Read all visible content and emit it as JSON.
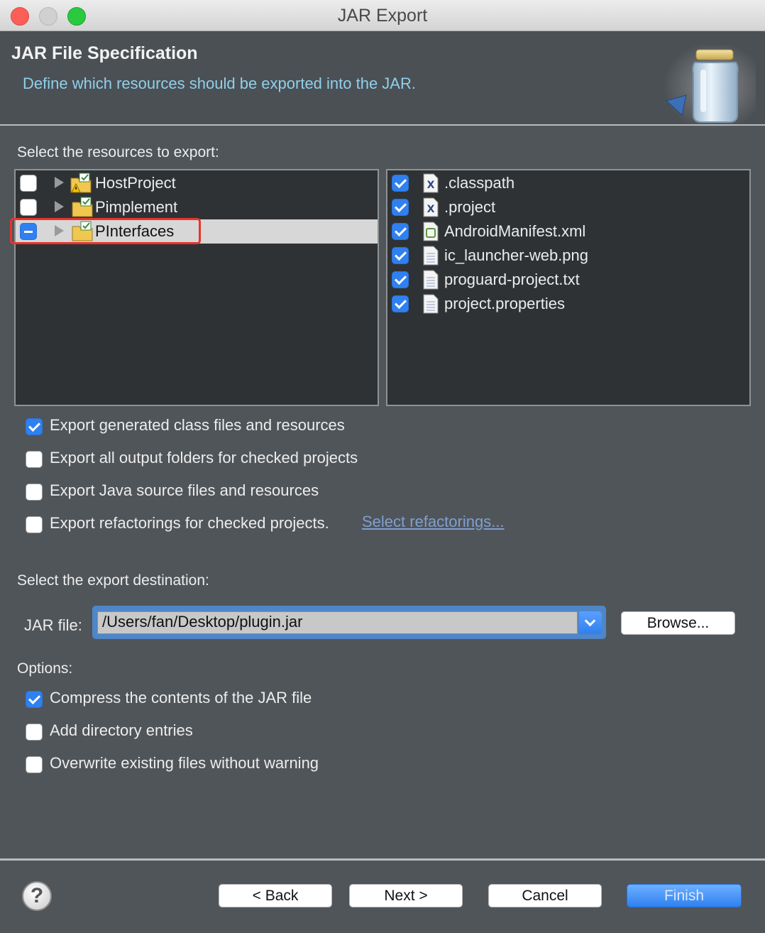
{
  "window": {
    "title": "JAR Export"
  },
  "header": {
    "title": "JAR File Specification",
    "description": "Define which resources should be exported into the JAR."
  },
  "resources": {
    "label": "Select the resources to export:",
    "projects": [
      {
        "name": "HostProject",
        "state": "unchecked"
      },
      {
        "name": "Pimplement",
        "state": "unchecked"
      },
      {
        "name": "PInterfaces",
        "state": "partial",
        "selected": true
      }
    ],
    "files": [
      {
        "name": ".classpath",
        "checked": true,
        "icon": "xml-x-file-icon"
      },
      {
        "name": ".project",
        "checked": true,
        "icon": "xml-x-file-icon"
      },
      {
        "name": "AndroidManifest.xml",
        "checked": true,
        "icon": "android-manifest-icon"
      },
      {
        "name": "ic_launcher-web.png",
        "checked": true,
        "icon": "text-file-icon"
      },
      {
        "name": "proguard-project.txt",
        "checked": true,
        "icon": "text-file-icon"
      },
      {
        "name": "project.properties",
        "checked": true,
        "icon": "text-file-icon"
      }
    ]
  },
  "export_options": [
    {
      "label": "Export generated class files and resources",
      "checked": true
    },
    {
      "label": "Export all output folders for checked projects",
      "checked": false
    },
    {
      "label": "Export Java source files and resources",
      "checked": false
    },
    {
      "label": "Export refactorings for checked projects.",
      "checked": false
    }
  ],
  "refactorings_link": "Select refactorings...",
  "destination": {
    "label": "Select the export destination:",
    "jar_label": "JAR file:",
    "jar_path": "/Users/fan/Desktop/plugin.jar",
    "browse_label": "Browse..."
  },
  "options": {
    "label": "Options:",
    "items": [
      {
        "label": "Compress the contents of the JAR file",
        "checked": true
      },
      {
        "label": "Add directory entries",
        "checked": false
      },
      {
        "label": "Overwrite existing files without warning",
        "checked": false
      }
    ]
  },
  "footer": {
    "help": "?",
    "back": "< Back",
    "next": "Next >",
    "cancel": "Cancel",
    "finish": "Finish"
  },
  "colors": {
    "accent": "#2f80f0",
    "description": "#8fd0ec",
    "highlight": "#e8342b"
  }
}
